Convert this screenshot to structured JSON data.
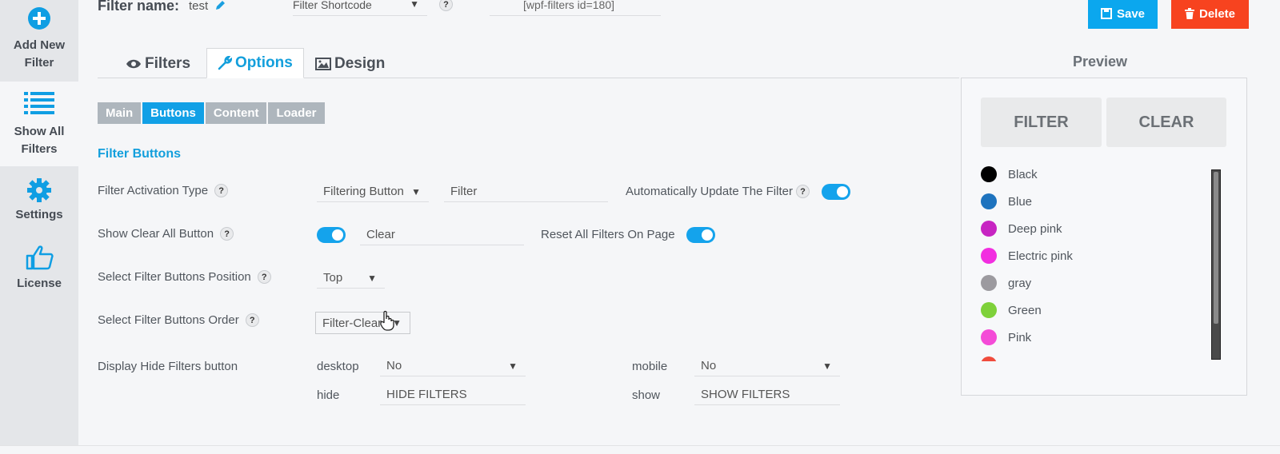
{
  "sidebar": {
    "items": [
      {
        "label": "Add New Filter",
        "icon": "plus-circle-icon"
      },
      {
        "label": "Show All Filters",
        "icon": "list-icon"
      },
      {
        "label": "Settings",
        "icon": "gear-icon"
      },
      {
        "label": "License",
        "icon": "thumbs-up-icon"
      }
    ]
  },
  "header": {
    "filter_name_label": "Filter name:",
    "filter_name_value": "test",
    "shortcode_select": "Filter Shortcode",
    "shortcode_value": "[wpf-filters id=180]",
    "save_label": "Save",
    "delete_label": "Delete",
    "help_glyph": "?"
  },
  "tabs": [
    {
      "label": "Filters",
      "icon": "eye-icon"
    },
    {
      "label": "Options",
      "icon": "wrench-icon",
      "active": true
    },
    {
      "label": "Design",
      "icon": "image-icon"
    }
  ],
  "subtabs": [
    {
      "label": "Main"
    },
    {
      "label": "Buttons",
      "active": true
    },
    {
      "label": "Content"
    },
    {
      "label": "Loader"
    }
  ],
  "section_title": "Filter Buttons",
  "options": {
    "activation_type": {
      "label": "Filter Activation Type",
      "select": "Filtering Button",
      "text": "Filter",
      "auto_update_label": "Automatically Update The Filter",
      "auto_update_on": true
    },
    "clear_all": {
      "label": "Show Clear All Button",
      "enabled": true,
      "text": "Clear",
      "reset_label": "Reset All Filters On Page",
      "reset_on": true
    },
    "position": {
      "label": "Select Filter Buttons Position",
      "select": "Top"
    },
    "order": {
      "label": "Select Filter Buttons Order",
      "select": "Filter-Clear"
    },
    "hide_filters": {
      "label": "Display Hide Filters button",
      "desktop_label": "desktop",
      "desktop_select": "No",
      "mobile_label": "mobile",
      "mobile_select": "No",
      "hide_label": "hide",
      "hide_text": "HIDE FILTERS",
      "show_label": "show",
      "show_text": "SHOW FILTERS"
    }
  },
  "preview": {
    "title": "Preview",
    "filter_button": "FILTER",
    "clear_button": "CLEAR",
    "colors": [
      {
        "name": "Black",
        "color": "#000000"
      },
      {
        "name": "Blue",
        "color": "#1e73be"
      },
      {
        "name": "Deep pink",
        "color": "#c724c2"
      },
      {
        "name": "Electric pink",
        "color": "#f22ee0"
      },
      {
        "name": "gray",
        "color": "#9c9a9f"
      },
      {
        "name": "Green",
        "color": "#7ed13a"
      },
      {
        "name": "Pink",
        "color": "#f44bd7"
      }
    ]
  },
  "colors": {
    "accent": "#139fdc",
    "save": "#0ba7ee",
    "delete": "#f7431f"
  }
}
